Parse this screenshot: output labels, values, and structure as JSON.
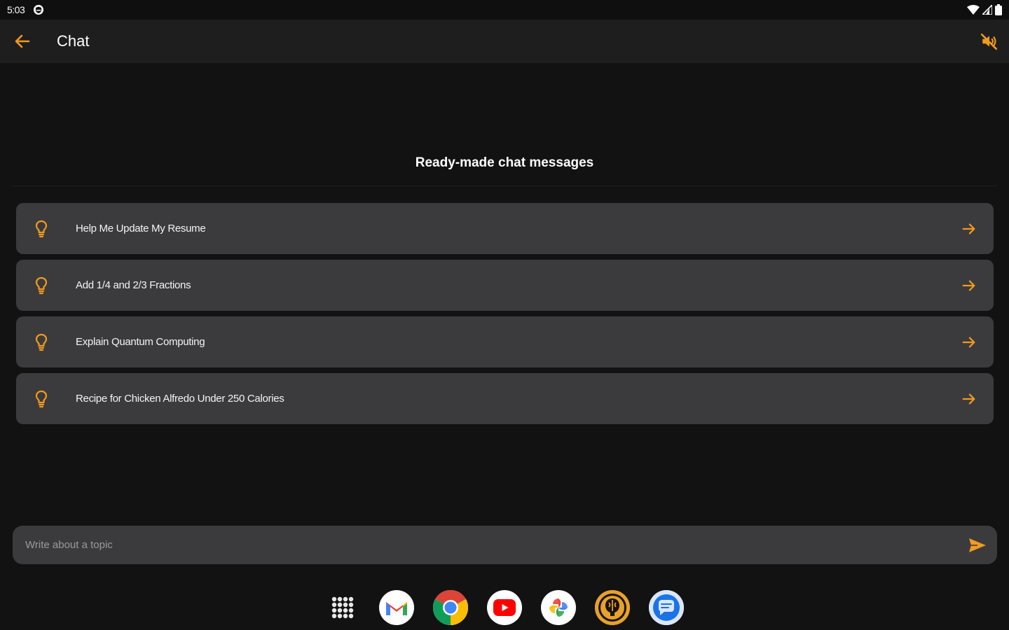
{
  "status_bar": {
    "time": "5:03"
  },
  "app_bar": {
    "title": "Chat"
  },
  "section": {
    "heading": "Ready-made chat messages"
  },
  "suggestions": [
    {
      "label": "Help Me Update My Resume"
    },
    {
      "label": "Add 1/4 and 2/3 Fractions"
    },
    {
      "label": "Explain Quantum Computing"
    },
    {
      "label": "Recipe for Chicken Alfredo Under 250 Calories"
    }
  ],
  "input": {
    "placeholder": "Write about a topic",
    "value": ""
  },
  "dock": {
    "apps": [
      {
        "icon": "app-drawer-icon"
      },
      {
        "icon": "gmail-icon"
      },
      {
        "icon": "chrome-icon"
      },
      {
        "icon": "youtube-icon"
      },
      {
        "icon": "photos-icon"
      },
      {
        "icon": "ai-chat-app-icon"
      },
      {
        "icon": "messages-icon"
      }
    ]
  },
  "colors": {
    "accent": "#f29a1f",
    "background": "#121213",
    "app_bar": "#1e1e1f",
    "card": "#3b3b3d"
  }
}
